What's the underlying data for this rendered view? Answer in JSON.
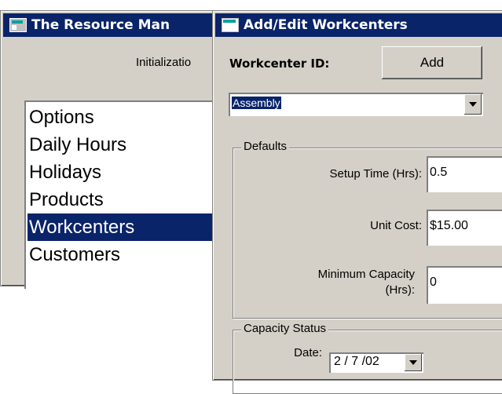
{
  "main_window": {
    "title": "The Resource Man",
    "subtitle": "Initializatio",
    "list_items": [
      {
        "label": "Options",
        "selected": false
      },
      {
        "label": "Daily Hours",
        "selected": false
      },
      {
        "label": "Holidays",
        "selected": false
      },
      {
        "label": "Products",
        "selected": false
      },
      {
        "label": "Workcenters",
        "selected": true
      },
      {
        "label": "Customers",
        "selected": false
      }
    ]
  },
  "dialog": {
    "title": "Add/Edit Workcenters",
    "workcenter_label": "Workcenter ID:",
    "add_button": "Add",
    "workcenter_value": "Assembly",
    "defaults": {
      "title": "Defaults",
      "setup_label": "Setup Time (Hrs):",
      "setup_value": "0.5",
      "unit_cost_label": "Unit Cost:",
      "unit_cost_value": "$15.00",
      "min_cap_label_1": "Minimum Capacity",
      "min_cap_label_2": "(Hrs):",
      "min_cap_value": "0"
    },
    "capacity_status": {
      "title": "Capacity Status",
      "date_label": "Date:",
      "date_value": "2 / 7 /02"
    }
  },
  "colors": {
    "title_bar": "#0a246a",
    "face": "#d4d0c8",
    "selection": "#0a246a"
  }
}
